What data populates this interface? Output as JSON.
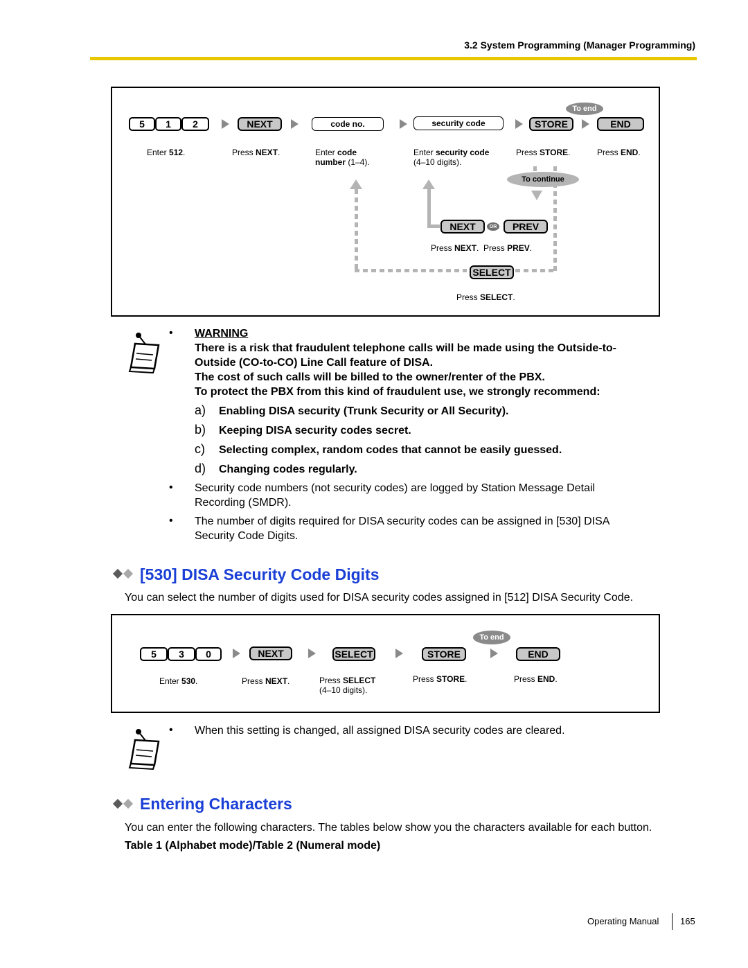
{
  "header": {
    "section_title": "3.2 System Programming (Manager Programming)"
  },
  "flow512": {
    "digits": [
      "5",
      "1",
      "2"
    ],
    "next_key": "NEXT",
    "code_field": "code no.",
    "security_field": "security code",
    "store_key": "STORE",
    "end_key": "END",
    "to_end": "To end",
    "to_continue": "To continue",
    "next2_key": "NEXT",
    "or": "OR",
    "prev_key": "PREV",
    "select_key": "SELECT",
    "captions": {
      "enter": "Enter ",
      "enter_b": "512",
      "enter_end": ".",
      "next": "Press ",
      "next_b": "NEXT",
      "next_end": ".",
      "code": "Enter ",
      "code_b": "code",
      "code_b2": "number",
      "code_end": " (1–4).",
      "sec": "Enter ",
      "sec_b": "security code",
      "sec_line2": "(4–10 digits).",
      "store": "Press ",
      "store_b": "STORE",
      "store_end": ".",
      "end": "Press ",
      "end_b": "END",
      "end_end": ".",
      "pn": "Press ",
      "pn_b": "NEXT",
      "pn_end": ".",
      "pp": "Press ",
      "pp_b": "PREV",
      "pp_end": ".",
      "sel": "Press ",
      "sel_b": "SELECT",
      "sel_end": "."
    }
  },
  "warning": {
    "bullet": "•",
    "title": "WARNING",
    "lines": [
      "There is a risk that fraudulent telephone calls will be made using the Outside-to-",
      "Outside (CO-to-CO) Line Call feature of DISA.",
      "The cost of such calls will be billed to the owner/renter of the PBX.",
      "To protect the PBX from this kind of fraudulent use, we strongly recommend:"
    ],
    "items": [
      {
        "label": "a)",
        "text": "Enabling DISA security (Trunk Security or All Security)."
      },
      {
        "label": "b)",
        "text": "Keeping DISA security codes secret."
      },
      {
        "label": "c)",
        "text": "Selecting complex, random codes that cannot be easily guessed."
      },
      {
        "label": "d)",
        "text": "Changing codes regularly."
      }
    ],
    "notes": [
      {
        "line1": "Security code numbers (not security codes) are logged by Station Message Detail",
        "line2": "Recording (SMDR)."
      },
      {
        "line1": "The number of digits required for DISA security codes can be assigned in [530] DISA",
        "line2": "Security Code Digits."
      }
    ]
  },
  "section530": {
    "heading": "[530] DISA Security Code Digits",
    "intro": "You can select the number of digits used for DISA security codes assigned in [512] DISA Security Code.",
    "digits": [
      "5",
      "3",
      "0"
    ],
    "next_key": "NEXT",
    "select_key": "SELECT",
    "store_key": "STORE",
    "end_key": "END",
    "to_end": "To end",
    "captions": {
      "enter": "Enter ",
      "enter_b": "530",
      "enter_end": ".",
      "next": "Press ",
      "next_b": "NEXT",
      "next_end": ".",
      "sel": "Press ",
      "sel_b": "SELECT",
      "sel_line2": "(4–10 digits).",
      "store": "Press ",
      "store_b": "STORE",
      "store_end": ".",
      "end": "Press ",
      "end_b": "END",
      "end_end": "."
    },
    "note": "When this setting is changed, all assigned DISA security codes are cleared."
  },
  "entering": {
    "heading": "Entering Characters",
    "intro": "You can enter the following characters. The tables below show you the characters available for each button.",
    "table_caption": "Table 1 (Alphabet mode)/Table 2 (Numeral mode)"
  },
  "footer": {
    "manual": "Operating Manual",
    "page": "165"
  }
}
